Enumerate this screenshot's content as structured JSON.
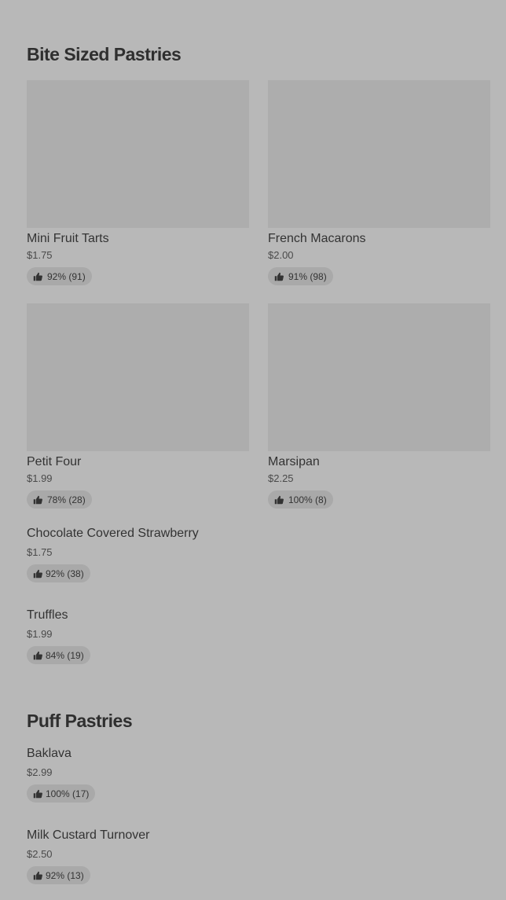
{
  "sections": [
    {
      "title": "Bite Sized Pastries",
      "grid_items": [
        {
          "name": "Mini Fruit Tarts",
          "price": "$1.75",
          "rating": "92% (91)"
        },
        {
          "name": "French Macarons",
          "price": "$2.00",
          "rating": "91% (98)"
        },
        {
          "name": "Petit Four",
          "price": "$1.99",
          "rating": "78% (28)"
        },
        {
          "name": "Marsipan",
          "price": "$2.25",
          "rating": "100% (8)"
        }
      ],
      "list_items": [
        {
          "name": "Chocolate Covered Strawberry",
          "price": "$1.75",
          "rating": "92% (38)"
        },
        {
          "name": "Truffles",
          "price": "$1.99",
          "rating": "84% (19)"
        }
      ]
    },
    {
      "title": "Puff Pastries",
      "list_items": [
        {
          "name": "Baklava",
          "price": "$2.99",
          "rating": "100% (17)"
        },
        {
          "name": "Milk Custard Turnover",
          "price": "$2.50",
          "rating": "92% (13)"
        }
      ]
    }
  ],
  "icons": {
    "rating": "thumbs-up-icon"
  },
  "colors": {
    "background": "#b8b8b8",
    "image_placeholder": "#adadad",
    "rating_pill": "#a9a9a9"
  }
}
